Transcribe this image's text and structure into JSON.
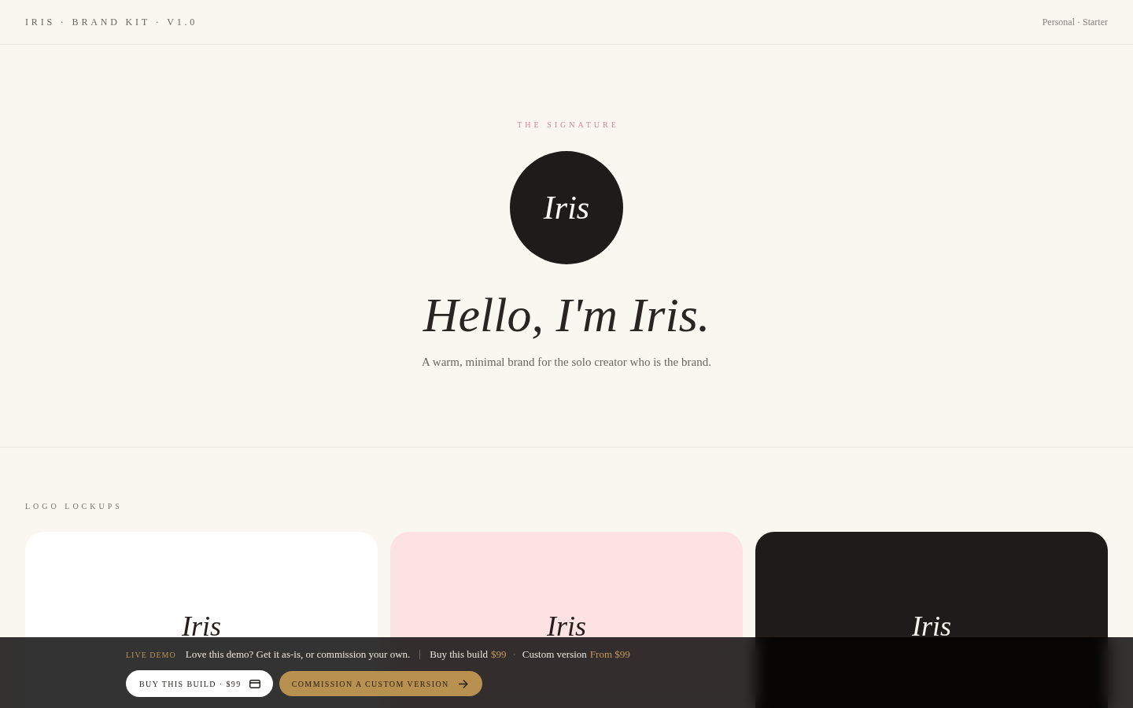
{
  "header": {
    "title": "IRIS · BRAND KIT · V1.0",
    "plan": "Personal · Starter"
  },
  "hero": {
    "eyebrow": "THE SIGNATURE",
    "monogram": "Iris",
    "headline": "Hello, I'm Iris.",
    "tagline": "A warm, minimal brand for the solo creator who is the brand."
  },
  "lockups": {
    "heading": "LOGO LOCKUPS",
    "cards": [
      {
        "wordmark": "Iris",
        "color": "#ffffff"
      },
      {
        "wordmark": "Iris",
        "color": "#fde2e4"
      },
      {
        "wordmark": "Iris",
        "color": "#1f1b18"
      }
    ]
  },
  "demo_bar": {
    "badge": "LIVE DEMO",
    "message": "Love this demo? Get it as-is, or commission your own.",
    "offers": [
      {
        "label": "Buy this build",
        "price": "$99"
      },
      {
        "label": "Custom version",
        "price": "From $99"
      }
    ],
    "separator": "·",
    "buttons": [
      {
        "label": "BUY THIS BUILD · $99",
        "kind": "light"
      },
      {
        "label": "COMMISSION A CUSTOM VERSION",
        "kind": "accent"
      }
    ]
  }
}
